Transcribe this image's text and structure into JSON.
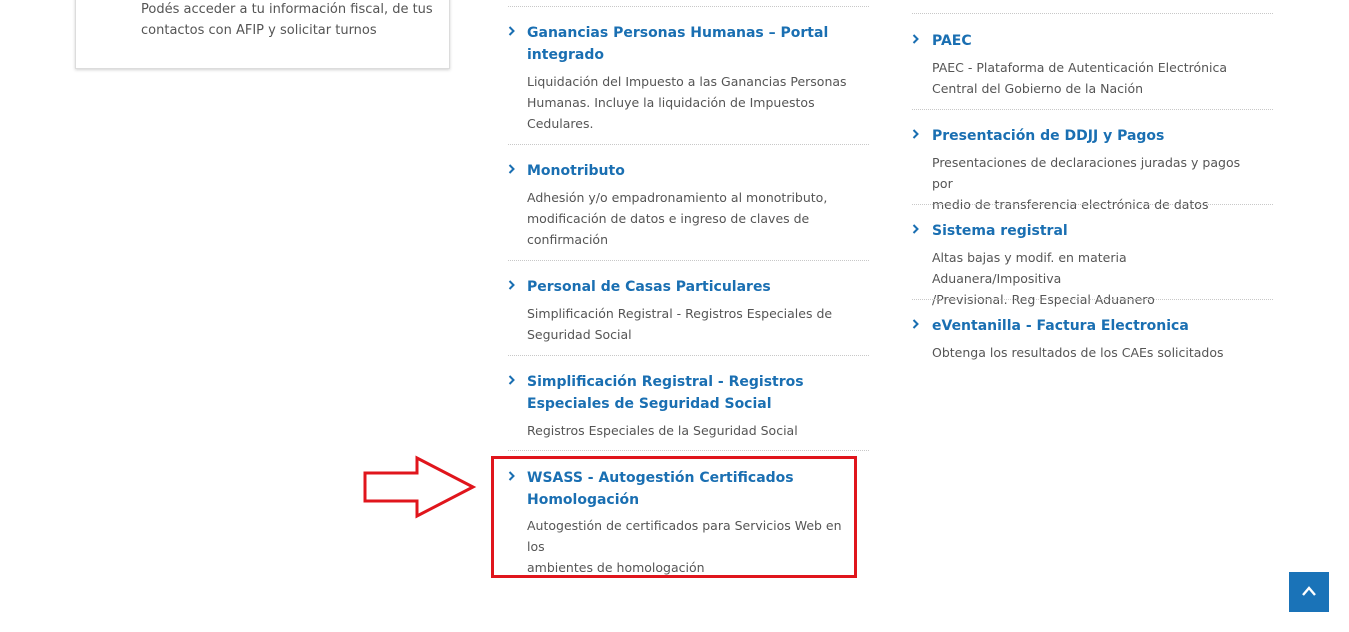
{
  "left_card": {
    "text": "Podés acceder a tu información fiscal, de tus contactos con AFIP y solicitar turnos"
  },
  "middle_column": {
    "items": [
      {
        "title_lines": [
          "Ganancias Personas Humanas – Portal",
          "integrado"
        ],
        "description_lines": [
          "Liquidación del Impuesto a las Ganancias Personas",
          "Humanas. Incluye la liquidación de Impuestos",
          "Cedulares."
        ]
      },
      {
        "title_lines": [
          "Monotributo"
        ],
        "description_lines": [
          "Adhesión y/o empadronamiento al monotributo,",
          "modificación de datos e ingreso de claves de",
          "confirmación"
        ]
      },
      {
        "title_lines": [
          "Personal de Casas Particulares"
        ],
        "description_lines": [
          "Simplificación Registral - Registros Especiales de",
          "Seguridad Social"
        ]
      },
      {
        "title_lines": [
          "Simplificación Registral - Registros",
          "Especiales de Seguridad Social"
        ],
        "description_lines": [
          "Registros Especiales de la Seguridad Social"
        ]
      },
      {
        "title_lines": [
          "WSASS - Autogestión Certificados",
          "Homologación"
        ],
        "description_lines": [
          "Autogestión de certificados para Servicios Web en los",
          "ambientes de homologación"
        ]
      }
    ]
  },
  "right_column": {
    "items": [
      {
        "title_lines": [
          "PAEC"
        ],
        "description_lines": [
          "PAEC - Plataforma de Autenticación Electrónica",
          "Central del Gobierno de la Nación"
        ]
      },
      {
        "title_lines": [
          "Presentación de DDJJ y Pagos"
        ],
        "description_lines": [
          "Presentaciones de declaraciones juradas y pagos por",
          "medio de transferencia electrónica de datos"
        ]
      },
      {
        "title_lines": [
          "Sistema registral"
        ],
        "description_lines": [
          "Altas bajas y modif. en materia Aduanera/Impositiva",
          "/Previsional. Reg Especial Aduanero"
        ]
      },
      {
        "title_lines": [
          "eVentanilla - Factura Electronica"
        ],
        "description_lines": [
          "Obtenga los resultados de los CAEs solicitados"
        ]
      }
    ]
  },
  "icons": {
    "chevron": "chevron-right-icon",
    "back_to_top": "chevron-up-icon",
    "annotation_arrow": "arrow-right-icon"
  },
  "colors": {
    "link": "#1a6fb2",
    "text": "#555555",
    "highlight": "#e0151c",
    "back_to_top_bg": "#1a73b8"
  }
}
